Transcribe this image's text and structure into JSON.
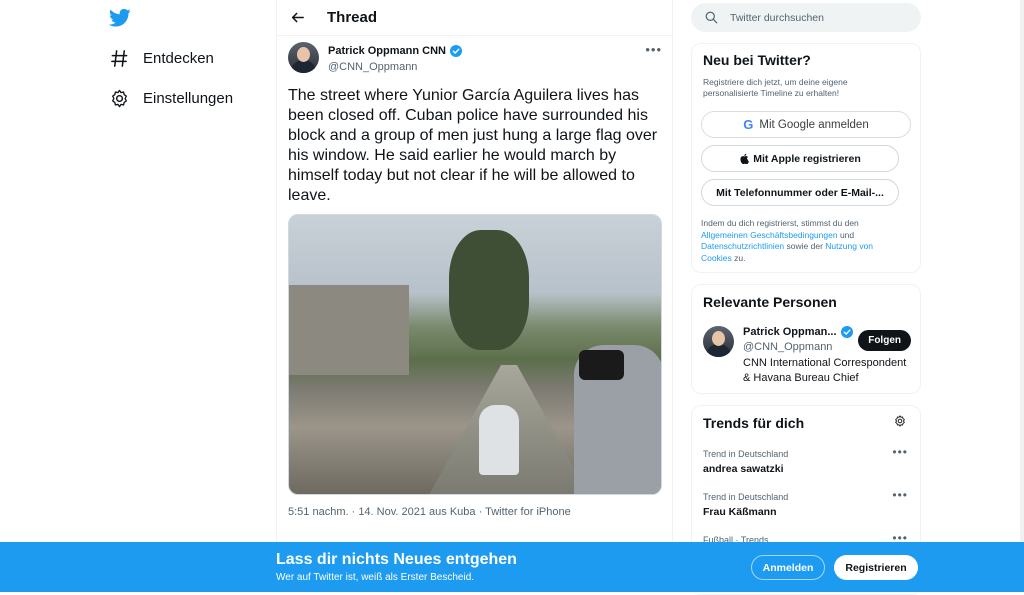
{
  "nav": {
    "items": [
      {
        "label": "Entdecken",
        "icon": "hashtag-icon"
      },
      {
        "label": "Einstellungen",
        "icon": "gear-icon"
      }
    ]
  },
  "thread": {
    "title": "Thread",
    "author_name": "Patrick Oppmann CNN",
    "author_handle": "@CNN_Oppmann",
    "text": "The street where Yunior García Aguilera lives has been closed off. Cuban police have surrounded his block and a group of men just hung a large flag over his window. He said earlier he would march by himself today but not clear if he will be allowed to leave.",
    "meta": "5:51 nachm. · 14. Nov. 2021 aus Kuba · Twitter for iPhone"
  },
  "search": {
    "placeholder": "Twitter durchsuchen"
  },
  "signup": {
    "title": "Neu bei Twitter?",
    "subtitle": "Registriere dich jetzt, um deine eigene personalisierte Timeline zu erhalten!",
    "google_label": "Mit Google anmelden",
    "apple_label": "Mit Apple registrieren",
    "phone_label": "Mit Telefonnummer oder E-Mail-...",
    "legal_prefix": "Indem du dich registrierst, stimmst du den",
    "legal_terms": "Allgemeinen Geschäftsbedingungen",
    "legal_and": "und",
    "legal_privacy": "Datenschutzrichtlinien",
    "legal_as": "sowie der",
    "legal_cookies": "Nutzung von Cookies",
    "legal_suffix": "zu."
  },
  "people": {
    "title": "Relevante Personen",
    "name": "Patrick Oppman...",
    "handle": "@CNN_Oppmann",
    "bio": "CNN International Correspondent & Havana Bureau Chief",
    "follow_label": "Folgen"
  },
  "trends": {
    "title": "Trends für dich",
    "items": [
      {
        "context": "Trend in Deutschland",
        "name": "andrea sawatzki"
      },
      {
        "context": "Trend in Deutschland",
        "name": "Frau Käßmann"
      },
      {
        "context": "Fußball · Trends",
        "name": ""
      }
    ]
  },
  "bottom_bar": {
    "title": "Lass dir nichts Neues entgehen",
    "subtitle": "Wer auf Twitter ist, weiß als Erster Bescheid.",
    "login_label": "Anmelden",
    "register_label": "Registrieren"
  },
  "colors": {
    "accent": "#1d9bf0",
    "text": "#0f1419",
    "muted": "#536471"
  }
}
